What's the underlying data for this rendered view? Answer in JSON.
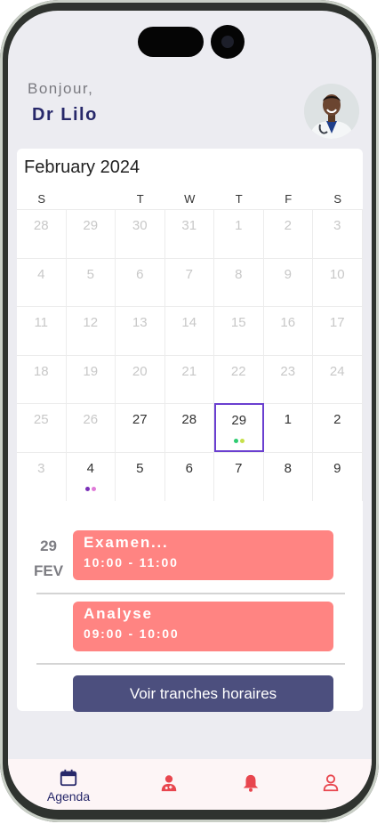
{
  "header": {
    "greeting": "Bonjour,",
    "doctor_name": "Dr Lilo"
  },
  "calendar": {
    "month_label": "February 2024",
    "weekdays": [
      "S",
      "",
      "T",
      "W",
      "T",
      "F",
      "S"
    ],
    "weeks": [
      [
        {
          "d": "28",
          "m": true
        },
        {
          "d": "29",
          "m": true
        },
        {
          "d": "30",
          "m": true
        },
        {
          "d": "31",
          "m": true
        },
        {
          "d": "1",
          "m": true
        },
        {
          "d": "2",
          "m": true
        },
        {
          "d": "3",
          "m": true
        }
      ],
      [
        {
          "d": "4",
          "m": true
        },
        {
          "d": "5",
          "m": true
        },
        {
          "d": "6",
          "m": true
        },
        {
          "d": "7",
          "m": true
        },
        {
          "d": "8",
          "m": true
        },
        {
          "d": "9",
          "m": true
        },
        {
          "d": "10",
          "m": true
        }
      ],
      [
        {
          "d": "11",
          "m": true
        },
        {
          "d": "12",
          "m": true
        },
        {
          "d": "13",
          "m": true
        },
        {
          "d": "14",
          "m": true
        },
        {
          "d": "15",
          "m": true
        },
        {
          "d": "16",
          "m": true
        },
        {
          "d": "17",
          "m": true
        }
      ],
      [
        {
          "d": "18",
          "m": true
        },
        {
          "d": "19",
          "m": true
        },
        {
          "d": "20",
          "m": true
        },
        {
          "d": "21",
          "m": true
        },
        {
          "d": "22",
          "m": true
        },
        {
          "d": "23",
          "m": true
        },
        {
          "d": "24",
          "m": true
        }
      ],
      [
        {
          "d": "25",
          "m": true
        },
        {
          "d": "26",
          "m": true
        },
        {
          "d": "27",
          "m": false
        },
        {
          "d": "28",
          "m": false
        },
        {
          "d": "29",
          "m": false,
          "sel": true,
          "dots": [
            "#2ecc71",
            "#c6e04a"
          ]
        },
        {
          "d": "1",
          "m": false
        },
        {
          "d": "2",
          "m": false
        }
      ],
      [
        {
          "d": "3",
          "m": true
        },
        {
          "d": "4",
          "m": false,
          "dots": [
            "#7a2fb8",
            "#e07bd8"
          ]
        },
        {
          "d": "5",
          "m": false
        },
        {
          "d": "6",
          "m": false
        },
        {
          "d": "7",
          "m": false
        },
        {
          "d": "8",
          "m": false
        },
        {
          "d": "9",
          "m": false
        }
      ]
    ]
  },
  "events": {
    "day": "29",
    "month": "FEV",
    "items": [
      {
        "title": "Examen...",
        "time": "10:00 - 11:00"
      },
      {
        "title": "Analyse",
        "time": "09:00 - 10:00"
      }
    ],
    "button_label": "Voir tranches horaires"
  },
  "nav": {
    "items": [
      {
        "label": "Agenda",
        "icon": "calendar-icon"
      },
      {
        "label": "",
        "icon": "doctor-icon"
      },
      {
        "label": "",
        "icon": "bell-icon"
      },
      {
        "label": "",
        "icon": "user-icon"
      }
    ]
  },
  "colors": {
    "accent": "#27286a",
    "event": "#ff8482",
    "button": "#4c4f7e",
    "selection": "#6a3fd0",
    "nav_icon": "#e8464e"
  }
}
